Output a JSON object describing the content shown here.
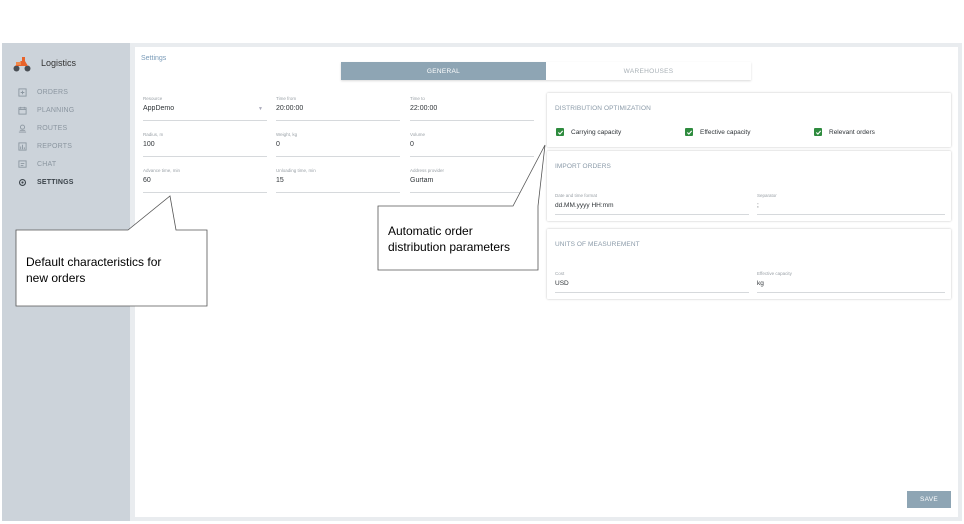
{
  "app": {
    "name": "Logistics"
  },
  "nav": {
    "items": [
      {
        "label": "ORDERS",
        "icon": "orders-icon"
      },
      {
        "label": "PLANNING",
        "icon": "calendar-icon"
      },
      {
        "label": "ROUTES",
        "icon": "route-icon"
      },
      {
        "label": "REPORTS",
        "icon": "chart-icon"
      },
      {
        "label": "CHAT",
        "icon": "chat-icon"
      },
      {
        "label": "SETTINGS",
        "icon": "gear-icon",
        "active": true
      }
    ]
  },
  "page": {
    "title": "Settings"
  },
  "tabs": [
    {
      "label": "GENERAL",
      "active": true
    },
    {
      "label": "WAREHOUSES",
      "active": false
    }
  ],
  "general": {
    "resource": {
      "label": "Resource",
      "value": "AppDemo"
    },
    "time_from": {
      "label": "Time from",
      "value": "20:00:00"
    },
    "time_to": {
      "label": "Time to",
      "value": "22:00:00"
    },
    "radius": {
      "label": "Radius, m",
      "value": "100"
    },
    "weight": {
      "label": "Weight, kg",
      "value": "0"
    },
    "volume": {
      "label": "Volume",
      "value": "0"
    },
    "advance_time": {
      "label": "Advance time, min",
      "value": "60"
    },
    "unloading_time": {
      "label": "Unloading time, min",
      "value": "15"
    },
    "address_provider": {
      "label": "Address provider",
      "value": "Gurtam"
    }
  },
  "distribution": {
    "title": "DISTRIBUTION OPTIMIZATION",
    "options": [
      {
        "label": "Carrying capacity",
        "checked": true
      },
      {
        "label": "Effective capacity",
        "checked": true
      },
      {
        "label": "Relevant orders",
        "checked": true
      }
    ]
  },
  "import_orders": {
    "title": "IMPORT ORDERS",
    "date_format": {
      "label": "Date and time format",
      "value": "dd.MM.yyyy HH:mm"
    },
    "separator": {
      "label": "Separator",
      "value": ";"
    }
  },
  "units": {
    "title": "UNITS OF MEASUREMENT",
    "cost": {
      "label": "Cost",
      "value": "USD"
    },
    "effective_capacity": {
      "label": "Effective capacity",
      "value": "kg"
    }
  },
  "actions": {
    "save": "SAVE"
  },
  "callouts": {
    "defaults": [
      "Default characteristics for",
      "new orders"
    ],
    "distribution": [
      "Automatic order",
      "distribution parameters"
    ]
  },
  "colors": {
    "accent": "#8ea5b4",
    "check": "#2e8b3e",
    "sidebar": "#ccd3da"
  }
}
